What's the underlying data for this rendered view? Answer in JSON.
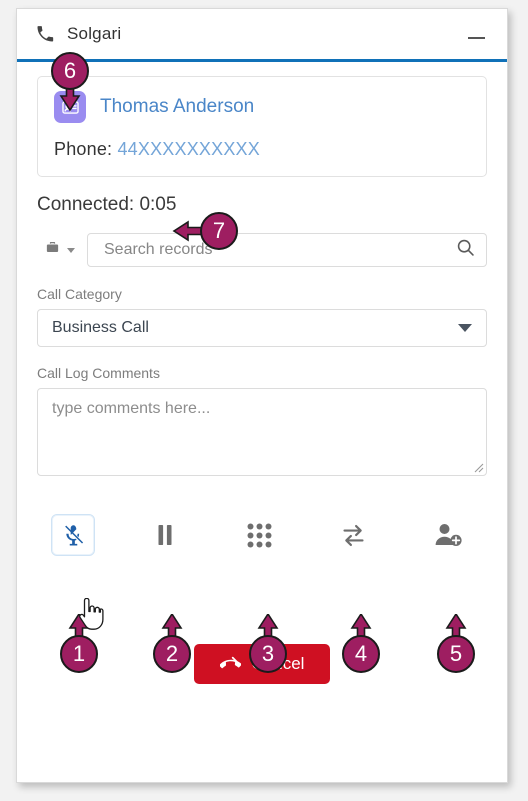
{
  "window": {
    "app_title": "Solgari",
    "phone_icon": "phone-handset-icon",
    "minimize_label": "minimize-icon",
    "accent_rule_color": "#1071b8"
  },
  "contact": {
    "icon": "contact-card-icon",
    "name": "Thomas Anderson",
    "phone_label": "Phone:",
    "phone_value": "44XXXXXXXXXX",
    "name_color": "#4a86c8",
    "phone_value_color": "#74a5d8",
    "icon_bg": "#9a8cf0"
  },
  "status": {
    "text": "Connected: 0:05"
  },
  "search": {
    "scope_icon": "briefcase-icon",
    "scope_caret": "chevron-down-icon",
    "placeholder": "Search records",
    "value": "",
    "search_icon": "search-icon"
  },
  "call_category": {
    "label": "Call Category",
    "selected": "Business Call",
    "caret": "chevron-down-icon",
    "options": [
      "Business Call"
    ]
  },
  "call_log": {
    "label": "Call Log Comments",
    "placeholder": "type comments here...",
    "value": "",
    "resize_handle": "resize-grip-icon"
  },
  "controls": [
    {
      "name": "mute",
      "icon": "microphone-muted-icon",
      "state": "active",
      "badge": "1"
    },
    {
      "name": "hold",
      "icon": "pause-icon",
      "state": "default",
      "badge": "2"
    },
    {
      "name": "keypad",
      "icon": "dialpad-icon",
      "state": "default",
      "badge": "3"
    },
    {
      "name": "transfer",
      "icon": "transfer-arrows-icon",
      "state": "default",
      "badge": "4"
    },
    {
      "name": "add-participant",
      "icon": "add-person-icon",
      "state": "default",
      "badge": "5"
    }
  ],
  "footer": {
    "cancel_label": "Cancel",
    "cancel_icon": "hangup-phone-icon",
    "cancel_color": "#cf1022"
  },
  "annotations": {
    "badge_color": "#9e1e61",
    "items": [
      {
        "number": "6",
        "target": "contact-card-icon",
        "direction": "down"
      },
      {
        "number": "7",
        "target": "connected-status",
        "direction": "left"
      },
      {
        "number": "1",
        "target": "mute-button",
        "direction": "up"
      },
      {
        "number": "2",
        "target": "hold-button",
        "direction": "up"
      },
      {
        "number": "3",
        "target": "keypad-button",
        "direction": "up"
      },
      {
        "number": "4",
        "target": "transfer-button",
        "direction": "up"
      },
      {
        "number": "5",
        "target": "add-participant-button",
        "direction": "up"
      }
    ],
    "cursor": "hand-pointer-cursor"
  }
}
